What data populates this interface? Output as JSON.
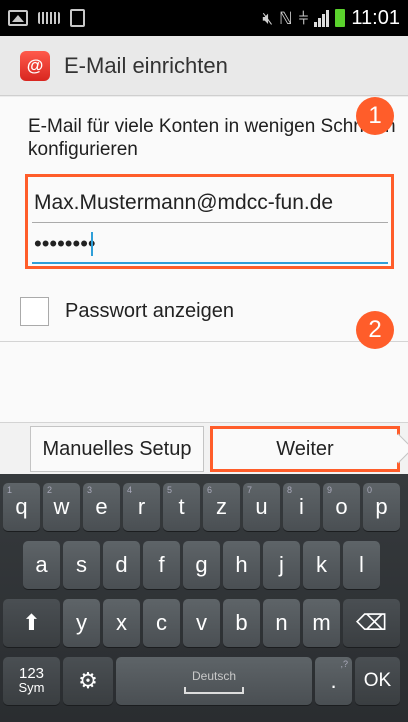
{
  "status_bar": {
    "time": "11:01",
    "left_icons": [
      "image-icon",
      "keyboard-icon",
      "doc-icon"
    ],
    "right_icons": [
      "mute-icon",
      "nfc-icon",
      "wifi-icon",
      "signal-icon",
      "battery-icon"
    ],
    "battery_color": "#5bd22d"
  },
  "action_bar": {
    "icon_glyph": "@",
    "title": "E-Mail einrichten"
  },
  "content": {
    "intro": "E-Mail für viele Konten in wenigen Schritten konfigurieren",
    "email_value": "Max.Mustermann@mdcc-fun.de",
    "password_value": "••••••••",
    "show_password_label": "Passwort anzeigen",
    "badge_1": "1",
    "badge_2": "2",
    "accent_color": "#ff5d2a",
    "focus_color": "#2f9fd8"
  },
  "buttons": {
    "manual_setup": "Manuelles Setup",
    "next": "Weiter"
  },
  "keyboard": {
    "row1": [
      {
        "key": "q",
        "hint": "1"
      },
      {
        "key": "w",
        "hint": "2"
      },
      {
        "key": "e",
        "hint": "3"
      },
      {
        "key": "r",
        "hint": "4"
      },
      {
        "key": "t",
        "hint": "5"
      },
      {
        "key": "z",
        "hint": "6"
      },
      {
        "key": "u",
        "hint": "7"
      },
      {
        "key": "i",
        "hint": "8"
      },
      {
        "key": "o",
        "hint": "9"
      },
      {
        "key": "p",
        "hint": "0"
      }
    ],
    "row2": [
      "a",
      "s",
      "d",
      "f",
      "g",
      "h",
      "j",
      "k",
      "l"
    ],
    "row3": [
      "y",
      "x",
      "c",
      "v",
      "b",
      "n",
      "m"
    ],
    "shift": "⬆",
    "backspace": "⌫",
    "sym_top": "123",
    "sym_bottom": "Sym",
    "settings": "⚙",
    "space_label": "Deutsch",
    "period": ".",
    "period_hint": ",?",
    "ok": "OK"
  }
}
